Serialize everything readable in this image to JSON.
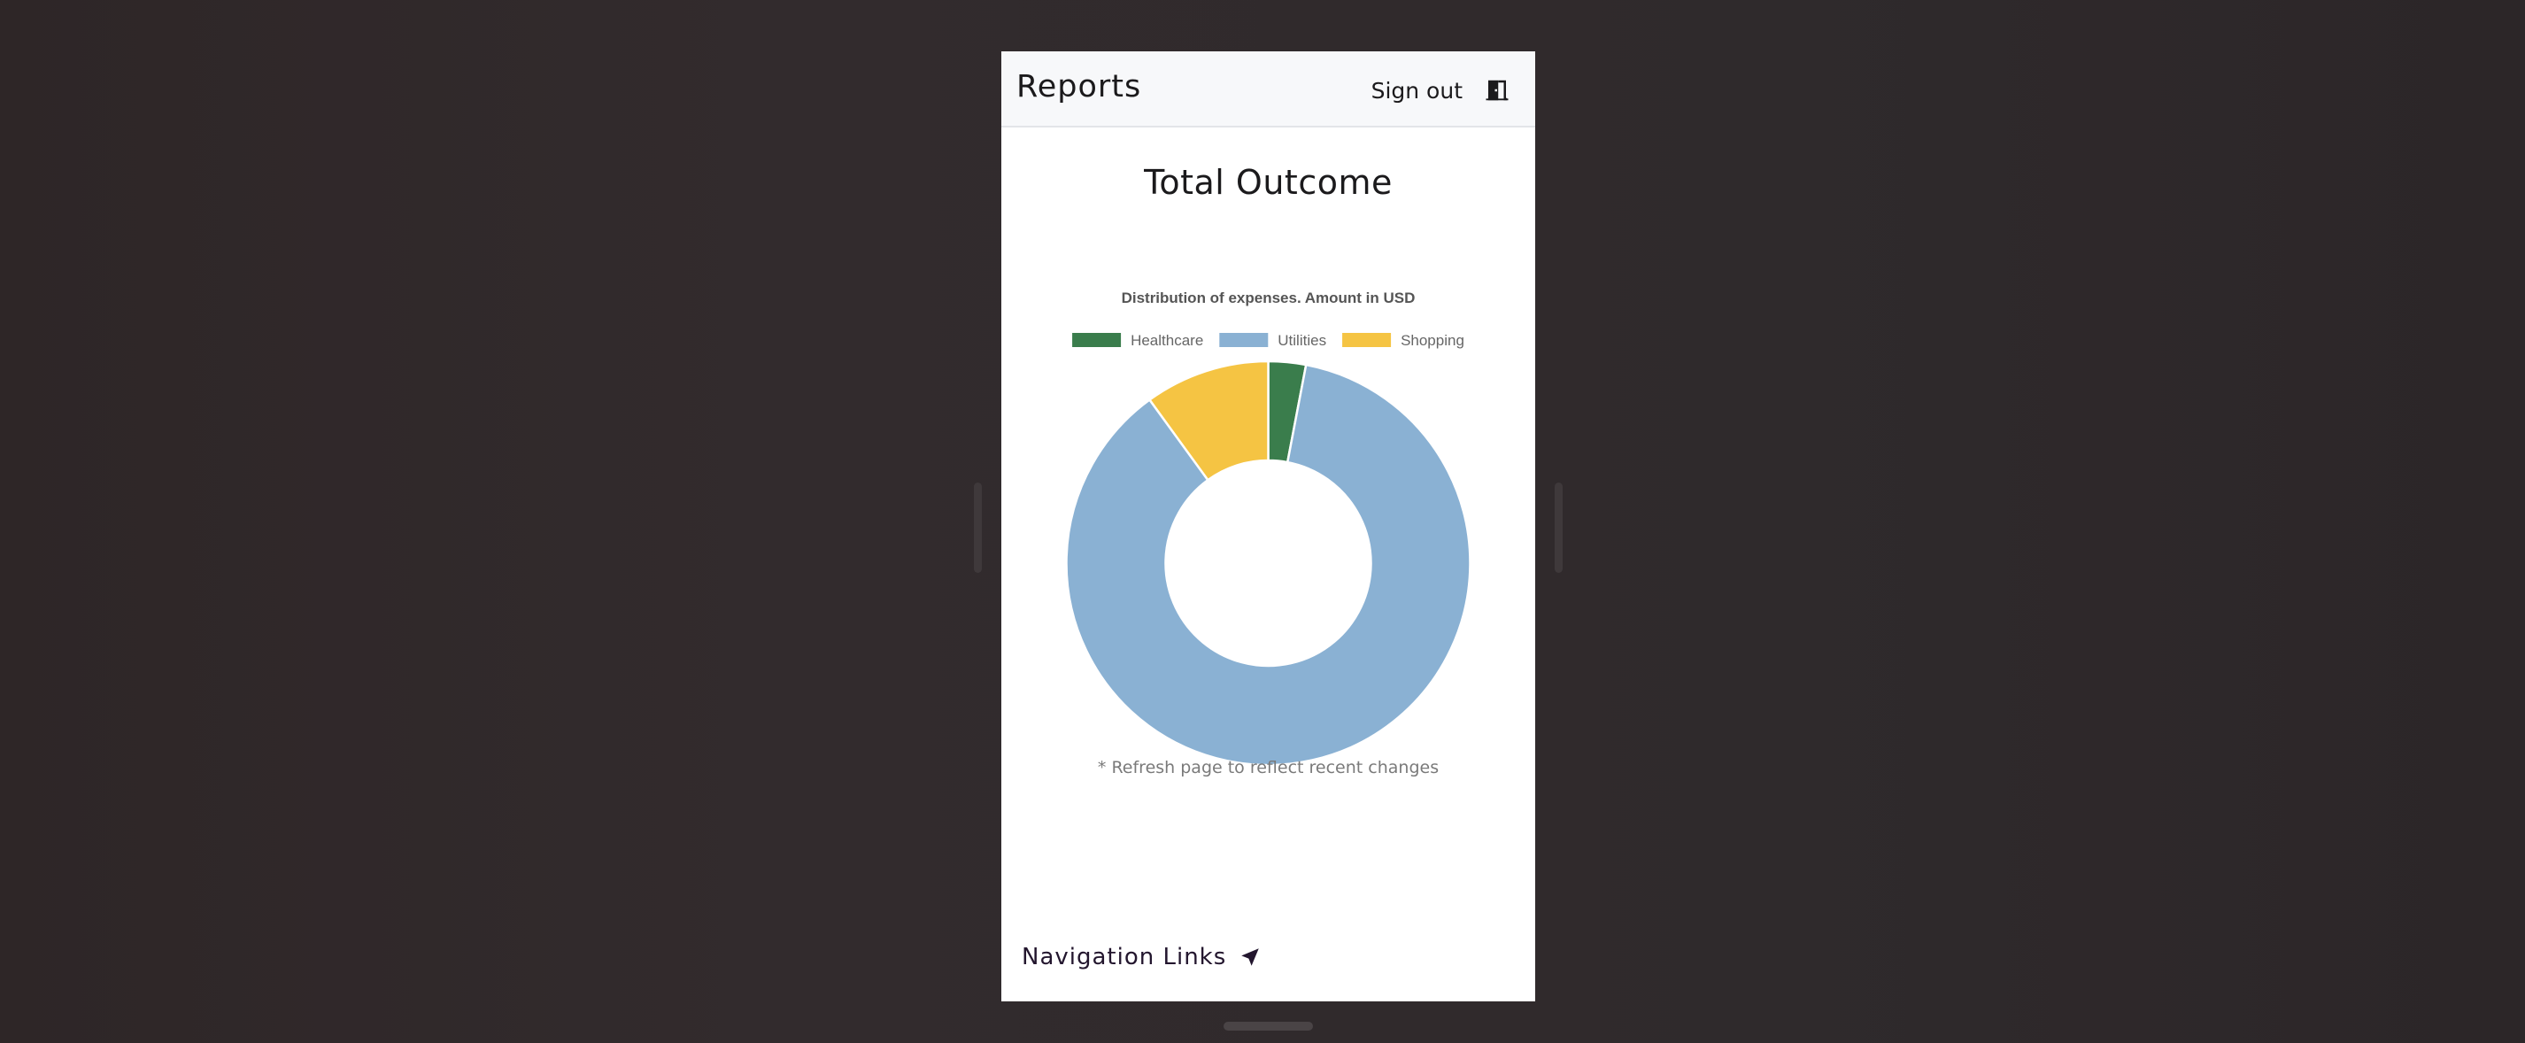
{
  "header": {
    "title": "Reports",
    "signout_label": "Sign out",
    "signout_icon": "door-exit-icon"
  },
  "report": {
    "title": "Total Outcome",
    "footnote": "* Refresh page to reflect recent changes"
  },
  "navigation": {
    "label": "Navigation Links",
    "icon": "navigation-arrow-icon"
  },
  "chart_data": {
    "type": "pie",
    "subtitle": "Distribution of expenses. Amount in USD",
    "legend_position": "top",
    "donut": true,
    "categories": [
      "Healthcare",
      "Utilities",
      "Shopping"
    ],
    "values": [
      3,
      87,
      10
    ],
    "colors": [
      "#3a7d4c",
      "#8ab1d3",
      "#f5c443"
    ]
  }
}
